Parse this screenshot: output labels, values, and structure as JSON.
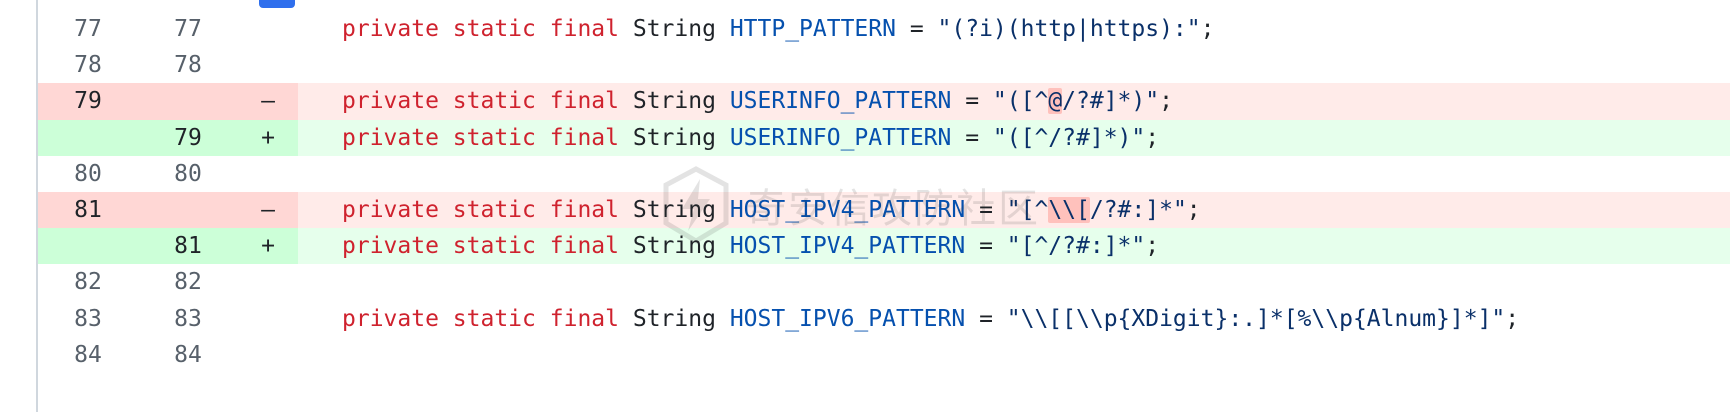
{
  "diff": {
    "rows": [
      {
        "type": "ctx",
        "old": "77",
        "new": "77",
        "sign": "",
        "parts": [
          {
            "cls": "kw",
            "t": "private"
          },
          {
            "cls": "plain",
            "t": " "
          },
          {
            "cls": "kw",
            "t": "static"
          },
          {
            "cls": "plain",
            "t": " "
          },
          {
            "cls": "kw",
            "t": "final"
          },
          {
            "cls": "plain",
            "t": " "
          },
          {
            "cls": "type",
            "t": "String"
          },
          {
            "cls": "plain",
            "t": " "
          },
          {
            "cls": "ident",
            "t": "HTTP_PATTERN"
          },
          {
            "cls": "plain",
            "t": " = "
          },
          {
            "cls": "str",
            "t": "\"(?i)(http|https):\""
          },
          {
            "cls": "plain",
            "t": ";"
          }
        ]
      },
      {
        "type": "ctx",
        "old": "78",
        "new": "78",
        "sign": "",
        "parts": []
      },
      {
        "type": "del",
        "old": "79",
        "new": "",
        "sign": "–",
        "parts": [
          {
            "cls": "kw",
            "t": "private"
          },
          {
            "cls": "plain",
            "t": " "
          },
          {
            "cls": "kw",
            "t": "static"
          },
          {
            "cls": "plain",
            "t": " "
          },
          {
            "cls": "kw",
            "t": "final"
          },
          {
            "cls": "plain",
            "t": " "
          },
          {
            "cls": "type",
            "t": "String"
          },
          {
            "cls": "plain",
            "t": " "
          },
          {
            "cls": "ident",
            "t": "USERINFO_PATTERN"
          },
          {
            "cls": "plain",
            "t": " = "
          },
          {
            "cls": "str",
            "t": "\"([^"
          },
          {
            "cls": "str hl-del",
            "t": "@"
          },
          {
            "cls": "str",
            "t": "/?#]*)\""
          },
          {
            "cls": "plain",
            "t": ";"
          }
        ]
      },
      {
        "type": "add",
        "old": "",
        "new": "79",
        "sign": "+",
        "parts": [
          {
            "cls": "kw",
            "t": "private"
          },
          {
            "cls": "plain",
            "t": " "
          },
          {
            "cls": "kw",
            "t": "static"
          },
          {
            "cls": "plain",
            "t": " "
          },
          {
            "cls": "kw",
            "t": "final"
          },
          {
            "cls": "plain",
            "t": " "
          },
          {
            "cls": "type",
            "t": "String"
          },
          {
            "cls": "plain",
            "t": " "
          },
          {
            "cls": "ident",
            "t": "USERINFO_PATTERN"
          },
          {
            "cls": "plain",
            "t": " = "
          },
          {
            "cls": "str",
            "t": "\"([^/?#]*)\""
          },
          {
            "cls": "plain",
            "t": ";"
          }
        ]
      },
      {
        "type": "ctx",
        "old": "80",
        "new": "80",
        "sign": "",
        "parts": []
      },
      {
        "type": "del",
        "old": "81",
        "new": "",
        "sign": "–",
        "parts": [
          {
            "cls": "kw",
            "t": "private"
          },
          {
            "cls": "plain",
            "t": " "
          },
          {
            "cls": "kw",
            "t": "static"
          },
          {
            "cls": "plain",
            "t": " "
          },
          {
            "cls": "kw",
            "t": "final"
          },
          {
            "cls": "plain",
            "t": " "
          },
          {
            "cls": "type",
            "t": "String"
          },
          {
            "cls": "plain",
            "t": " "
          },
          {
            "cls": "ident",
            "t": "HOST_IPV4_PATTERN"
          },
          {
            "cls": "plain",
            "t": " = "
          },
          {
            "cls": "str",
            "t": "\"[^"
          },
          {
            "cls": "str hl-del",
            "t": "\\\\["
          },
          {
            "cls": "str",
            "t": "/?#:]*\""
          },
          {
            "cls": "plain",
            "t": ";"
          }
        ]
      },
      {
        "type": "add",
        "old": "",
        "new": "81",
        "sign": "+",
        "parts": [
          {
            "cls": "kw",
            "t": "private"
          },
          {
            "cls": "plain",
            "t": " "
          },
          {
            "cls": "kw",
            "t": "static"
          },
          {
            "cls": "plain",
            "t": " "
          },
          {
            "cls": "kw",
            "t": "final"
          },
          {
            "cls": "plain",
            "t": " "
          },
          {
            "cls": "type",
            "t": "String"
          },
          {
            "cls": "plain",
            "t": " "
          },
          {
            "cls": "ident",
            "t": "HOST_IPV4_PATTERN"
          },
          {
            "cls": "plain",
            "t": " = "
          },
          {
            "cls": "str",
            "t": "\"[^/?#:]*\""
          },
          {
            "cls": "plain",
            "t": ";"
          }
        ]
      },
      {
        "type": "ctx",
        "old": "82",
        "new": "82",
        "sign": "",
        "parts": []
      },
      {
        "type": "ctx",
        "old": "83",
        "new": "83",
        "sign": "",
        "parts": [
          {
            "cls": "kw",
            "t": "private"
          },
          {
            "cls": "plain",
            "t": " "
          },
          {
            "cls": "kw",
            "t": "static"
          },
          {
            "cls": "plain",
            "t": " "
          },
          {
            "cls": "kw",
            "t": "final"
          },
          {
            "cls": "plain",
            "t": " "
          },
          {
            "cls": "type",
            "t": "String"
          },
          {
            "cls": "plain",
            "t": " "
          },
          {
            "cls": "ident",
            "t": "HOST_IPV6_PATTERN"
          },
          {
            "cls": "plain",
            "t": " = "
          },
          {
            "cls": "str",
            "t": "\"\\\\[[\\\\p{XDigit}:.]*[%\\\\p{Alnum}]*]\""
          },
          {
            "cls": "plain",
            "t": ";"
          }
        ]
      },
      {
        "type": "ctx",
        "old": "84",
        "new": "84",
        "sign": "",
        "parts": []
      }
    ]
  },
  "watermark": {
    "text": "奇安信攻防社区"
  },
  "colors": {
    "keyword": "#cf222e",
    "identifier": "#0550ae",
    "deleted_bg": "#ffebe9",
    "added_bg": "#e6ffec"
  }
}
